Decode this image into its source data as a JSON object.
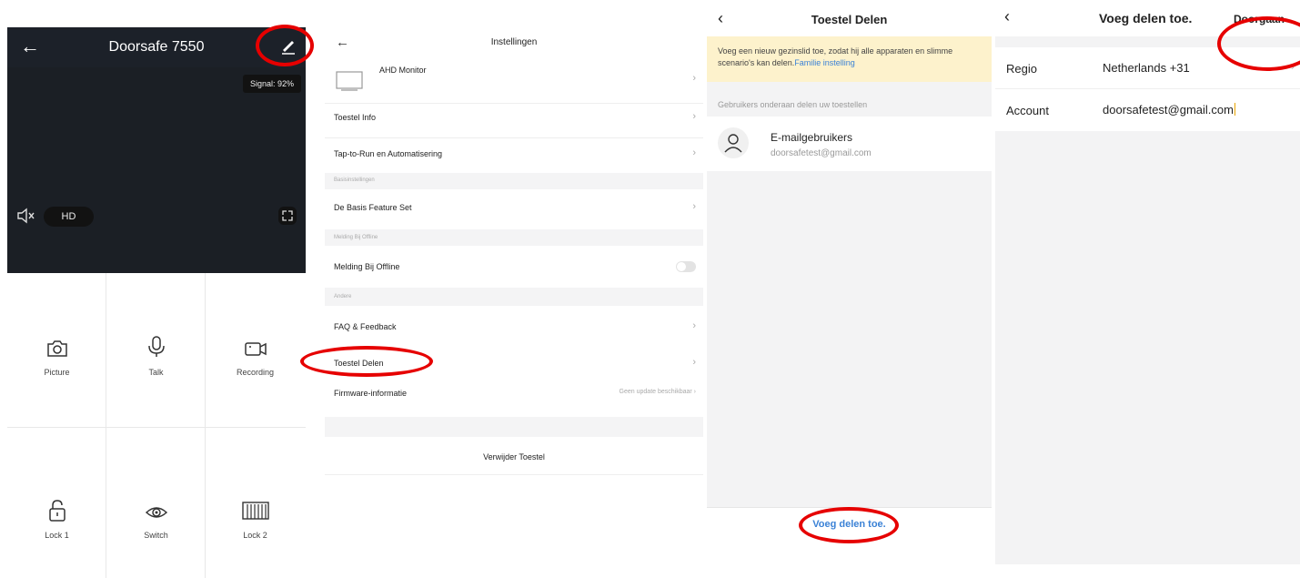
{
  "live_view": {
    "title": "Doorsafe 7550",
    "signal": "Signal: 92%",
    "quality": "HD",
    "actions": [
      {
        "label": "Picture",
        "icon": "camera-icon"
      },
      {
        "label": "Talk",
        "icon": "microphone-icon"
      },
      {
        "label": "Recording",
        "icon": "video-recording-icon"
      },
      {
        "label": "Lock 1",
        "icon": "lock-icon"
      },
      {
        "label": "Switch",
        "icon": "eye-icon"
      },
      {
        "label": "Lock 2",
        "icon": "gate-icon"
      }
    ]
  },
  "settings": {
    "title": "Instellingen",
    "device_name": "AHD Monitor",
    "items": {
      "toestel_info": "Toestel Info",
      "tap_to_run": "Tap-to-Run en Automatisering",
      "basis_section": "Basisinstellingen",
      "basis_feature": "De Basis Feature Set",
      "offline_section": "Melding Bij Offline",
      "offline_toggle": "Melding Bij Offline",
      "andere_section": "Andere",
      "faq": "FAQ & Feedback",
      "delen": "Toestel Delen",
      "firmware": "Firmware-informatie",
      "firmware_status": "Geen update beschikbaar"
    },
    "remove": "Verwijder Toestel"
  },
  "share": {
    "title": "Toestel Delen",
    "notice": "Voeg een nieuw gezinslid toe, zodat hij alle apparaten en slimme scenario's kan delen.",
    "notice_link": "Familie instelling",
    "subheader": "Gebruikers onderaan delen uw toestellen",
    "user_name": "E-mailgebruikers",
    "user_email": "doorsafetest@gmail.com",
    "add_button": "Voeg delen toe."
  },
  "add_share": {
    "title": "Voeg delen toe.",
    "continue": "Doorgaan",
    "region_label": "Regio",
    "region_value": "Netherlands +31",
    "account_label": "Account",
    "account_value": "doorsafetest@gmail.com"
  },
  "colors": {
    "annotation": "#e60000",
    "link": "#3b82d6",
    "topbar": "#1c2129",
    "notice_bg": "#fdf2cc"
  }
}
